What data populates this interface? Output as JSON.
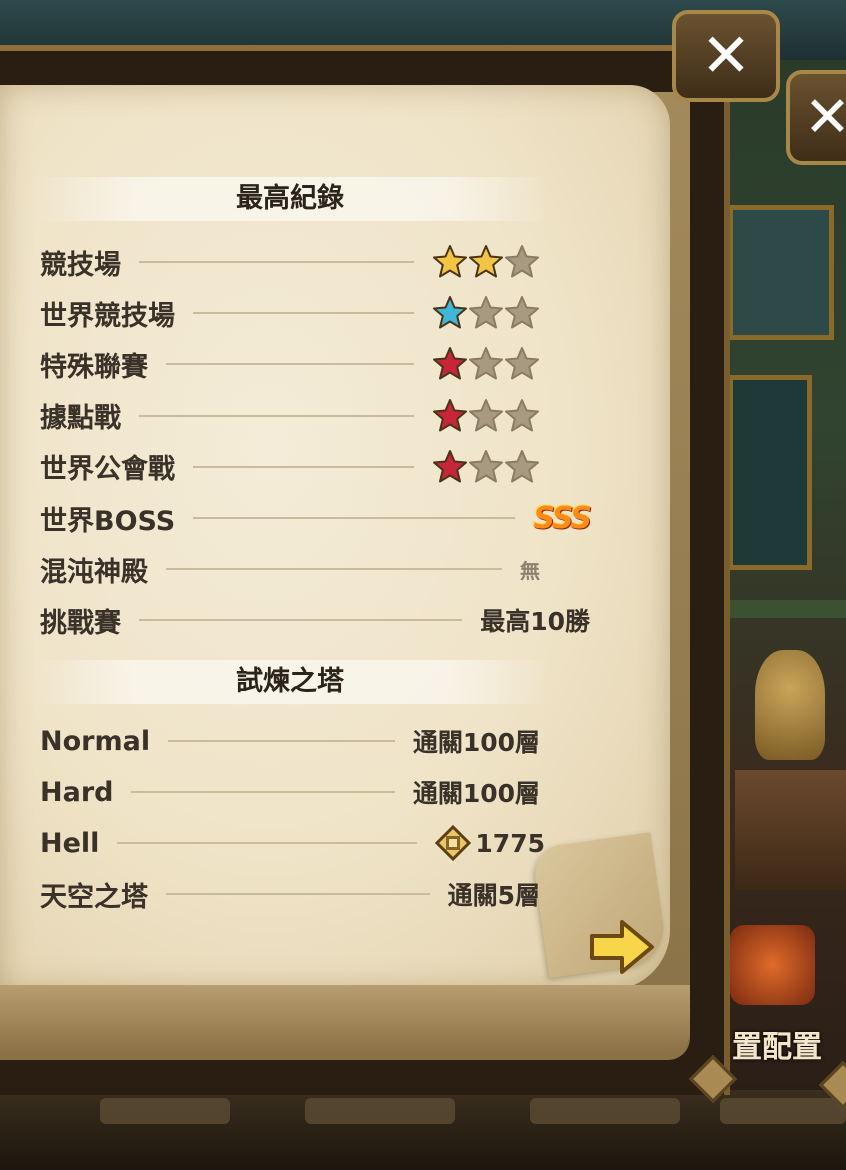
{
  "close_button": {
    "label": "✕"
  },
  "best_records": {
    "title": "最高紀錄",
    "rows": [
      {
        "label": "競技場",
        "stars": [
          "gold",
          "gold",
          "empty"
        ]
      },
      {
        "label": "世界競技場",
        "stars": [
          "blue",
          "empty",
          "empty"
        ]
      },
      {
        "label": "特殊聯賽",
        "stars": [
          "red",
          "empty",
          "empty"
        ]
      },
      {
        "label": "據點戰",
        "stars": [
          "red",
          "empty",
          "empty"
        ]
      },
      {
        "label": "世界公會戰",
        "stars": [
          "red",
          "empty",
          "empty"
        ]
      },
      {
        "label": "世界BOSS",
        "value": "SSS"
      },
      {
        "label": "混沌神殿",
        "value": "無"
      },
      {
        "label": "挑戰賽",
        "value": "最高10勝"
      }
    ]
  },
  "trial_tower": {
    "title": "試煉之塔",
    "rows": [
      {
        "label": "Normal",
        "value": "通關100層"
      },
      {
        "label": "Hard",
        "value": "通關100層"
      },
      {
        "label": "Hell",
        "value": "1775",
        "icon": "tower-medal-icon"
      },
      {
        "label": "天空之塔",
        "value": "通關5層"
      }
    ]
  },
  "background": {
    "deploy_label": "置配置"
  },
  "colors": {
    "star_gold": "#f4c542",
    "star_blue": "#3fb7d8",
    "star_red": "#c8243a",
    "star_empty": "#a89a80",
    "text": "#3a3128"
  }
}
